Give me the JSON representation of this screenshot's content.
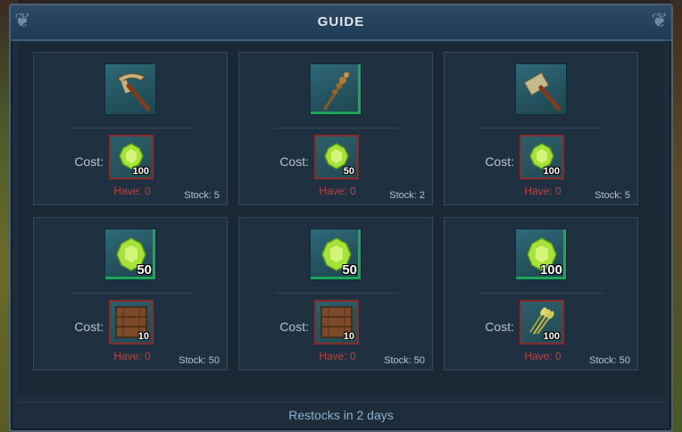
{
  "window": {
    "title": "GUIDE"
  },
  "labels": {
    "cost": "Cost:",
    "have_prefix": "Have: ",
    "stock_prefix": "Stock: "
  },
  "colors": {
    "panel_bg": "#1d2d3b",
    "header_bg": "#1f3a55",
    "slot_teal": "#2f6a78",
    "insufficient_red": "#c2403c",
    "gem_green": "#a7e23b"
  },
  "trades": [
    {
      "product": {
        "icon": "pickaxe-icon",
        "qty": ""
      },
      "cost": {
        "icon": "green-gem-icon",
        "qty": "100"
      },
      "have": "Have: 0",
      "stock": "Stock: 5"
    },
    {
      "product": {
        "icon": "staff-icon",
        "qty": ""
      },
      "cost": {
        "icon": "green-gem-icon",
        "qty": "50"
      },
      "have": "Have: 0",
      "stock": "Stock: 2"
    },
    {
      "product": {
        "icon": "hammer-icon",
        "qty": ""
      },
      "cost": {
        "icon": "green-gem-icon",
        "qty": "100"
      },
      "have": "Have: 0",
      "stock": "Stock: 5"
    },
    {
      "product": {
        "icon": "green-gem-icon",
        "qty": "50"
      },
      "cost": {
        "icon": "wood-crate-icon",
        "qty": "10"
      },
      "have": "Have: 0",
      "stock": "Stock: 50"
    },
    {
      "product": {
        "icon": "green-gem-icon",
        "qty": "50"
      },
      "cost": {
        "icon": "wood-crate-icon",
        "qty": "10"
      },
      "have": "Have: 0",
      "stock": "Stock: 50"
    },
    {
      "product": {
        "icon": "green-gem-icon",
        "qty": "100"
      },
      "cost": {
        "icon": "wheat-bundle-icon",
        "qty": "100"
      },
      "have": "Have: 0",
      "stock": "Stock: 50"
    }
  ],
  "footer": {
    "restock_text": "Restocks in 2 days"
  }
}
